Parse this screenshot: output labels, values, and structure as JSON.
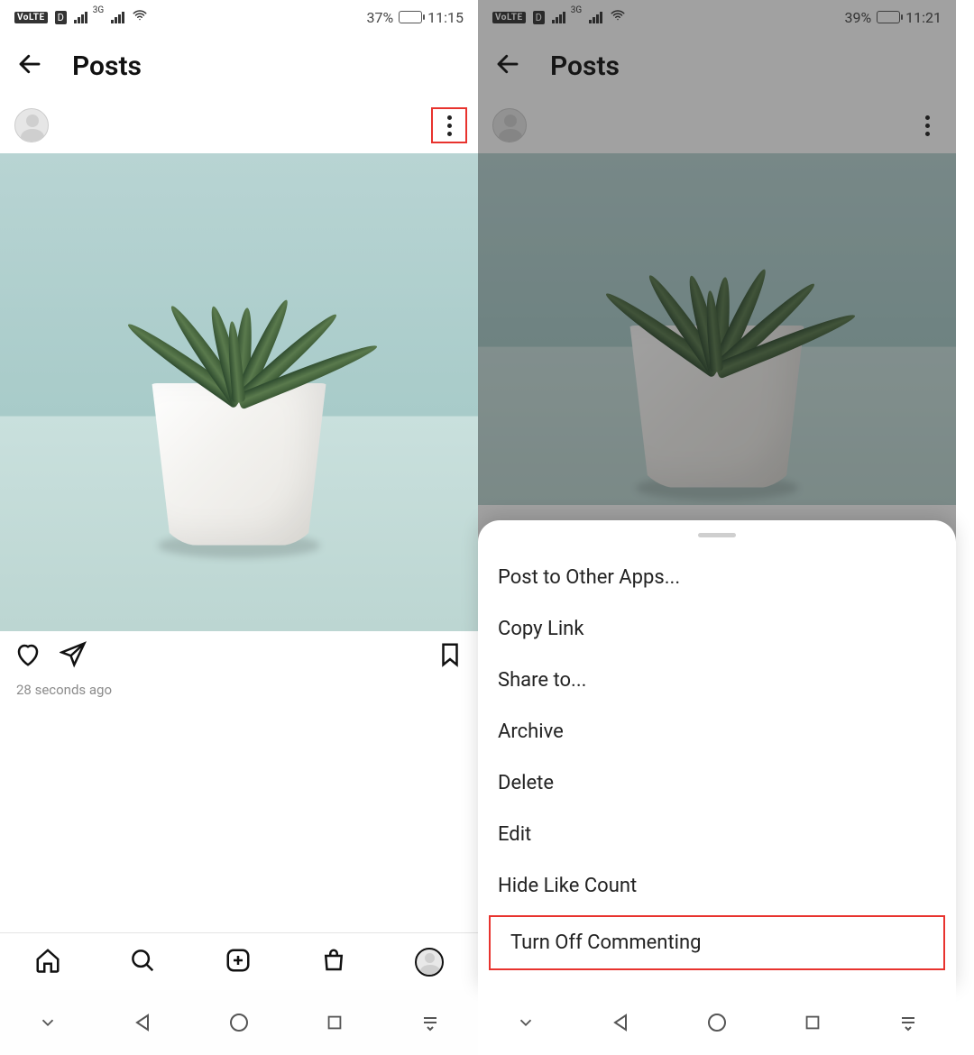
{
  "left": {
    "status": {
      "battery_pct": "37%",
      "time": "11:15"
    },
    "header_title": "Posts",
    "timestamp": "28 seconds ago"
  },
  "right": {
    "status": {
      "battery_pct": "39%",
      "time": "11:21"
    },
    "header_title": "Posts",
    "menu": {
      "items": [
        "Post to Other Apps...",
        "Copy Link",
        "Share to...",
        "Archive",
        "Delete",
        "Edit",
        "Hide Like Count",
        "Turn Off Commenting"
      ]
    }
  }
}
